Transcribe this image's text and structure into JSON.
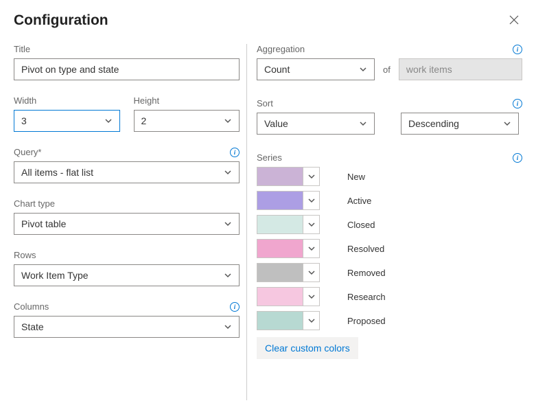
{
  "header": {
    "title": "Configuration"
  },
  "left": {
    "title": {
      "label": "Title",
      "value": "Pivot on type and state"
    },
    "width": {
      "label": "Width",
      "value": "3"
    },
    "height": {
      "label": "Height",
      "value": "2"
    },
    "query": {
      "label": "Query*",
      "value": "All items - flat list"
    },
    "chartType": {
      "label": "Chart type",
      "value": "Pivot table"
    },
    "rows": {
      "label": "Rows",
      "value": "Work Item Type"
    },
    "columns": {
      "label": "Columns",
      "value": "State"
    }
  },
  "right": {
    "aggregation": {
      "label": "Aggregation",
      "value": "Count",
      "ofLabel": "of",
      "ofValue": "work items"
    },
    "sort": {
      "label": "Sort",
      "value": "Value",
      "direction": "Descending"
    },
    "series": {
      "label": "Series",
      "items": [
        {
          "label": "New",
          "color": "#cbb3d6"
        },
        {
          "label": "Active",
          "color": "#ac9ee4"
        },
        {
          "label": "Closed",
          "color": "#d4e9e4"
        },
        {
          "label": "Resolved",
          "color": "#f0a6ce"
        },
        {
          "label": "Removed",
          "color": "#bfbfbf"
        },
        {
          "label": "Research",
          "color": "#f6c7e0"
        },
        {
          "label": "Proposed",
          "color": "#b7d9d2"
        }
      ],
      "clearLabel": "Clear custom colors"
    }
  }
}
